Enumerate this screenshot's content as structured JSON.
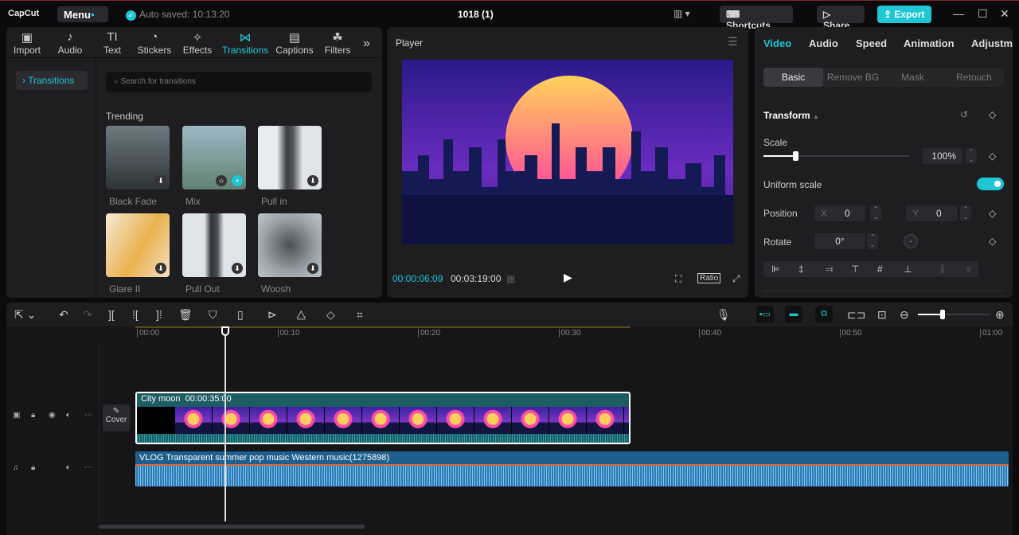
{
  "app": {
    "logo": "CapCut",
    "menu": "Menu",
    "autosave": "Auto saved: 10:13:20",
    "project": "1018 (1)",
    "shortcuts": "Shortcuts",
    "share": "Share",
    "export": "Export"
  },
  "left_tabs": [
    {
      "label": "Import",
      "icon": "▣"
    },
    {
      "label": "Audio",
      "icon": "♪"
    },
    {
      "label": "Text",
      "icon": "TI"
    },
    {
      "label": "Stickers",
      "icon": "◔"
    },
    {
      "label": "Effects",
      "icon": "✧"
    },
    {
      "label": "Transitions",
      "icon": "⋈"
    },
    {
      "label": "Captions",
      "icon": "▤"
    },
    {
      "label": "Filters",
      "icon": "☘"
    }
  ],
  "sidebar": {
    "item": "Transitions"
  },
  "search": {
    "placeholder": "Search for transitions"
  },
  "trending": {
    "title": "Trending",
    "items": [
      {
        "label": "Black Fade"
      },
      {
        "label": "Mix"
      },
      {
        "label": "Pull in"
      },
      {
        "label": "Glare II"
      },
      {
        "label": "Pull Out"
      },
      {
        "label": "Woosh"
      }
    ]
  },
  "player": {
    "title": "Player",
    "current": "00:00:06:09",
    "total": "00:03:19:00",
    "ratio": "Ratio"
  },
  "right_tabs": [
    "Video",
    "Audio",
    "Speed",
    "Animation",
    "Adjustme"
  ],
  "sub_tabs": [
    "Basic",
    "Remove BG",
    "Mask",
    "Retouch"
  ],
  "transform": {
    "title": "Transform",
    "scale_label": "Scale",
    "scale": "100%",
    "scale_value": 100,
    "uniform": "Uniform scale",
    "uniform_on": true,
    "position_label": "Position",
    "x_label": "X",
    "x": "0",
    "y_label": "Y",
    "y": "0",
    "rotate_label": "Rotate",
    "rotate": "0°"
  },
  "ruler": [
    "00:00",
    "00:10",
    "00:20",
    "00:30",
    "00:40",
    "00:50",
    "01:00"
  ],
  "video_clip": {
    "name": "City moon",
    "duration": "00:00:35:00"
  },
  "cover": "Cover",
  "audio_clip": {
    "name": "VLOG Transparent summer pop music Western music(1275898)"
  },
  "colors": {
    "accent": "#1fc7d4",
    "clip": "#1d5c63",
    "audio": "#1e5f8f"
  }
}
